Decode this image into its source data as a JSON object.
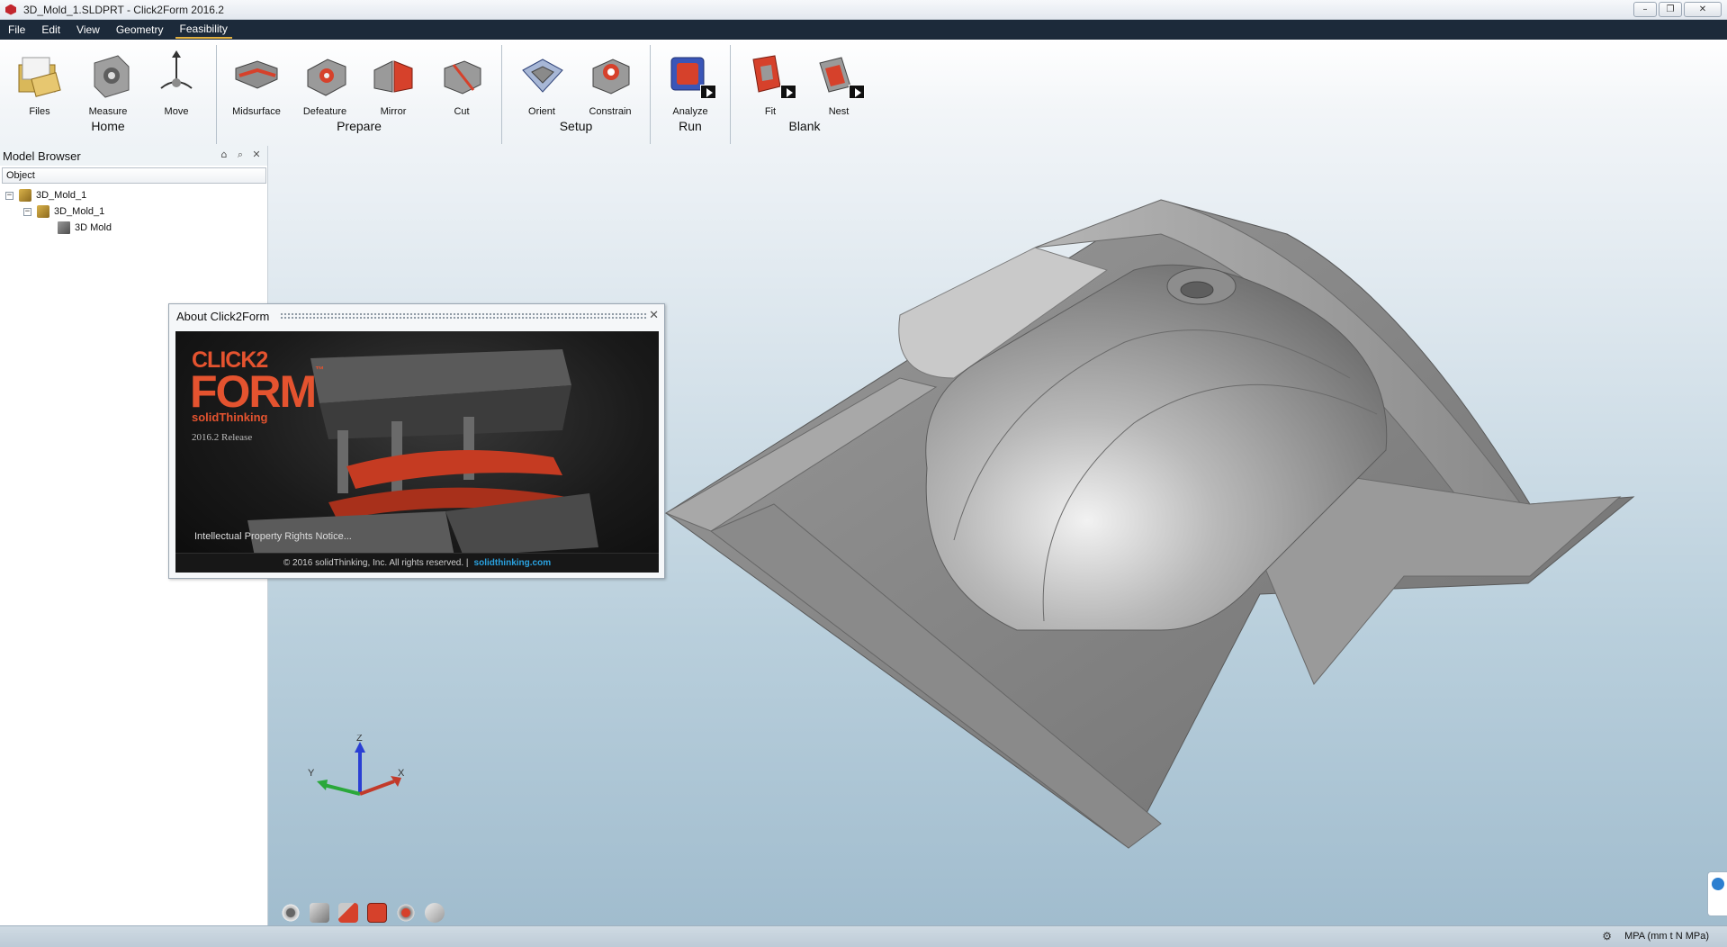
{
  "window": {
    "title": "3D_Mold_1.SLDPRT - Click2Form 2016.2",
    "minimize_glyph": "–",
    "restore_glyph": "❐",
    "close_glyph": "✕"
  },
  "menu": {
    "items": [
      "File",
      "Edit",
      "View",
      "Geometry",
      "Feasibility"
    ],
    "active": "Feasibility"
  },
  "ribbon": {
    "groups": [
      {
        "label": "Home",
        "tools": [
          "Files",
          "Measure",
          "Move"
        ]
      },
      {
        "label": "Prepare",
        "tools": [
          "Midsurface",
          "Defeature",
          "Mirror",
          "Cut"
        ]
      },
      {
        "label": "Setup",
        "tools": [
          "Orient",
          "Constrain"
        ]
      },
      {
        "label": "Run",
        "tools": [
          "Analyze"
        ]
      },
      {
        "label": "Blank",
        "tools": [
          "Fit",
          "Nest"
        ]
      }
    ]
  },
  "model_browser": {
    "title": "Model Browser",
    "column_header": "Object",
    "tree": [
      "3D_Mold_1",
      "3D_Mold_1",
      "3D Mold"
    ],
    "expander_glyph": "−"
  },
  "about_dialog": {
    "title": "About Click2Form",
    "close_glyph": "✕",
    "brand_line1": "CLICK2",
    "brand_line2": "FORM",
    "brand_trademark": "™",
    "brand_company": "solidThinking",
    "release": "2016.2 Release",
    "ip_notice": "Intellectual Property Rights Notice...",
    "copyright": "© 2016 solidThinking, Inc. All rights reserved.  |",
    "website": "solidthinking.com"
  },
  "axes": {
    "z": "Z",
    "y": "Y",
    "x": "X"
  },
  "status": {
    "units": "MPA (mm t N MPa)",
    "settings_glyph": "⚙"
  },
  "colors": {
    "menu_bg": "#1c2a3a",
    "accent_red": "#e4532f",
    "link_blue": "#2aa2e0",
    "mesh_gray": "#8c8c8c"
  }
}
